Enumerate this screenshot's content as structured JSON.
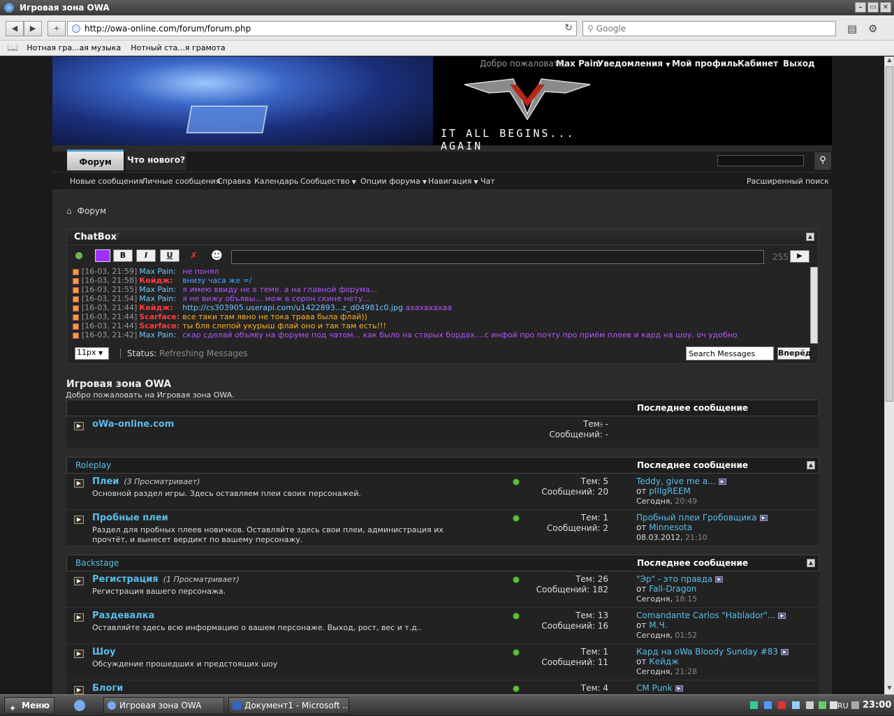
{
  "browser": {
    "window_title": "Игровая зона OWA",
    "url": "http://owa-online.com/forum/forum.php",
    "search_placeholder": "Google",
    "bookmarks": [
      "Нотная гра...ая музыка",
      "Нотный ста...я грамота"
    ]
  },
  "header": {
    "welcome": "Добро пожаловать,",
    "username": "Max Pain",
    "notifications": "Уведомления",
    "my_profile": "Мой профиль",
    "cabinet": "Кабинет",
    "logout": "Выход",
    "tagline": "IT ALL BEGINS... AGAIN"
  },
  "nav": {
    "tabs": [
      "Форум",
      "Что нового?"
    ],
    "subnav": [
      "Новые сообщения",
      "Личные сообщения",
      "Справка",
      "Календарь",
      "Сообщество",
      "Опции форума",
      "Навигация",
      "Чат"
    ],
    "advanced_search": "Расширенный поиск"
  },
  "breadcrumb": "Форум",
  "chatbox": {
    "title": "ChatBox",
    "bold": "B",
    "italic": "I",
    "underline": "U",
    "char_count": "255",
    "messages": [
      {
        "time": "[16-03, 21:59]",
        "user": "Max Pain:",
        "text": "не понял",
        "user_color": "#6ec7ff",
        "text_color": "#b455ff"
      },
      {
        "time": "[16-03, 21:58]",
        "user": "Кейдж:",
        "text": "внизу часа же =/",
        "user_color": "#ff3b3b",
        "text_color": "#4aa7ff"
      },
      {
        "time": "[16-03, 21:55]",
        "user": "Max Pain:",
        "text": "я имею ввиду не в теме. а на главной форума...",
        "user_color": "#6ec7ff",
        "text_color": "#b455ff"
      },
      {
        "time": "[16-03, 21:54]",
        "user": "Max Pain:",
        "text": "я не вижу объявы... мож в серон скине нету...",
        "user_color": "#6ec7ff",
        "text_color": "#b455ff"
      },
      {
        "time": "[16-03, 21:44]",
        "user": "Кейдж:",
        "text": "http://cs303905.userapi.com/u1422893...z_d04981c0.jpg",
        "text2": "ахахахахаа",
        "user_color": "#ff3b3b",
        "text_color": "#6ec7ff"
      },
      {
        "time": "[16-03, 21:44]",
        "user": "Scarface:",
        "text": "все таки там явно не тока трава была флай))",
        "user_color": "#ff3b3b",
        "text_color": "#ffb020"
      },
      {
        "time": "[16-03, 21:44]",
        "user": "Scarface:",
        "text": "ты бля слепой укурыш флай оно и так там есть!!!",
        "user_color": "#ff3b3b",
        "text_color": "#ffb020"
      },
      {
        "time": "[16-03, 21:42]",
        "user": "Max Pain:",
        "text": "скар сделай объяву на форуме под чатом... как было на старых бордах....с инфой про почту про приём плеев и кард на шоу. оч удобно",
        "user_color": "#6ec7ff",
        "text_color": "#b455ff"
      }
    ],
    "font_size": "11px",
    "status_label": "Status:",
    "status_value": "Refreshing Messages",
    "search_placeholder": "Search Messages",
    "go_button": "Вперёд"
  },
  "forum": {
    "title": "Игровая зона OWA",
    "description": "Добро пожаловать на Игровая зона OWA.",
    "last_post_header": "Последнее сообщение",
    "sections": [
      {
        "name": "",
        "forums": [
          {
            "name": "oWa-online.com",
            "viewers": "",
            "desc": "",
            "topics": "Тем: -",
            "posts": "Сообщений: -",
            "last_title": "-",
            "last_by_prefix": "",
            "last_by": "",
            "last_date": "",
            "last_time": ""
          }
        ]
      },
      {
        "name": "Roleplay",
        "forums": [
          {
            "name": "Плеи",
            "viewers": "(3 Просматривает)",
            "desc": "Основной раздел игры. Здесь оставляем плеи своих персонажей.",
            "topics": "Тем: 5",
            "posts": "Сообщений: 20",
            "last_title": "Teddy, give me a...",
            "last_by_prefix": "от",
            "last_by": "pIIIgREEM",
            "last_date": "Сегодня,",
            "last_time": "20:49"
          },
          {
            "name": "Пробные плеи",
            "viewers": "",
            "desc": "Раздел для пробных плеев новичков. Оставляйте здесь свои плеи, администрация их прочтёт, и вынесет вердикт по вашему персонажу.",
            "topics": "Тем: 1",
            "posts": "Сообщений: 2",
            "last_title": "Пробный плеи Гробовщика",
            "last_by_prefix": "от",
            "last_by": "Minnesota",
            "last_date": "08.03.2012,",
            "last_time": "21:10"
          }
        ]
      },
      {
        "name": "Backstage",
        "forums": [
          {
            "name": "Регистрация",
            "viewers": "(1 Просматривает)",
            "desc": "Регистрация вашего персонажа.",
            "topics": "Тем: 26",
            "posts": "Сообщений: 182",
            "last_title": "\"Эр\" - это правда",
            "last_by_prefix": "от",
            "last_by": "Fall-Dragon",
            "last_date": "Сегодня,",
            "last_time": "18:15"
          },
          {
            "name": "Раздевалка",
            "viewers": "",
            "desc": "Оставляйте здесь всю информацию о вашем персонаже. Выход, рост, вес и т.д..",
            "topics": "Тем: 13",
            "posts": "Сообщений: 16",
            "last_title": "Comandante Carlos \"Hablador\"...",
            "last_by_prefix": "от",
            "last_by": "М.Ч.",
            "last_date": "Сегодня,",
            "last_time": "01:52"
          },
          {
            "name": "Шоу",
            "viewers": "",
            "desc": "Обсуждение прошедших и предстоящих шоу",
            "topics": "Тем: 1",
            "posts": "Сообщений: 11",
            "last_title": "Кард на oWa Bloody Sunday #83",
            "last_by_prefix": "от",
            "last_by": "Кейдж",
            "last_date": "Сегодня,",
            "last_time": "21:28"
          },
          {
            "name": "Блоги",
            "viewers": "",
            "desc": "",
            "topics": "Тем: 4",
            "posts": "",
            "last_title": "CM Punk",
            "last_by_prefix": "",
            "last_by": "",
            "last_date": "",
            "last_time": ""
          }
        ]
      }
    ]
  },
  "taskbar": {
    "start": "Меню",
    "tasks": [
      "Игровая зона OWA",
      "Документ1 - Microsoft ..."
    ],
    "lang": "RU",
    "clock": "23:00"
  }
}
